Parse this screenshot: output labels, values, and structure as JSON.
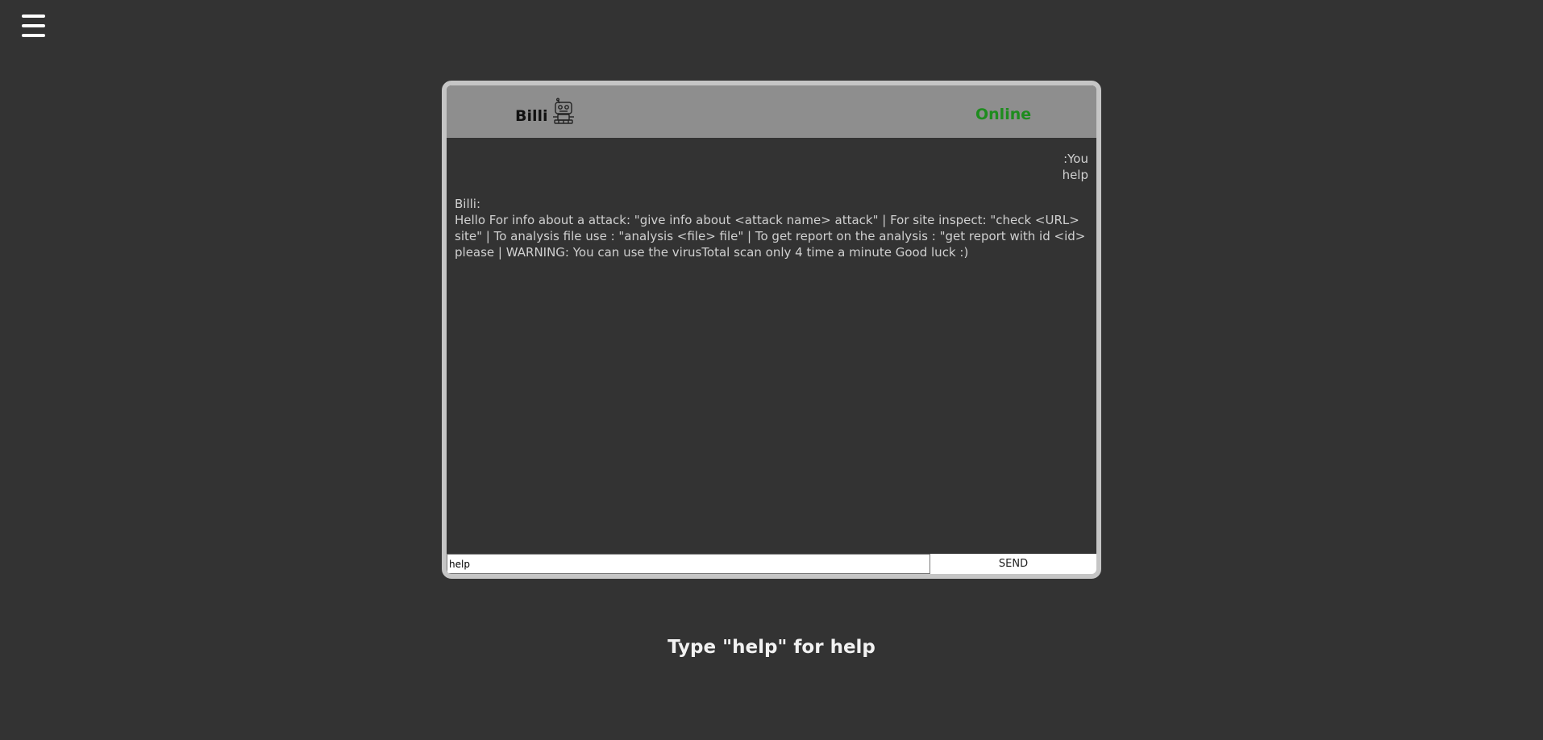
{
  "menu": {
    "icon": "hamburger-menu-icon"
  },
  "header": {
    "bot_name": "Billi",
    "bot_icon": "robot-icon",
    "status": "Online",
    "status_color": "#1e8c1e"
  },
  "messages": {
    "user": {
      "label": ":You",
      "text": "help"
    },
    "bot": {
      "label": "Billi:",
      "text": "Hello For info about a attack: \"give info about <attack name> attack\" | For site inspect: \"check <URL> site\" | To analysis file use : \"analysis <file> file\" | To get report on the analysis : \"get report with id <id> please | WARNING: You can use the virusTotal scan only 4 time a minute Good luck :)"
    }
  },
  "composer": {
    "value": "help",
    "send_label": "SEND"
  },
  "hint": "Type \"help\" for help"
}
